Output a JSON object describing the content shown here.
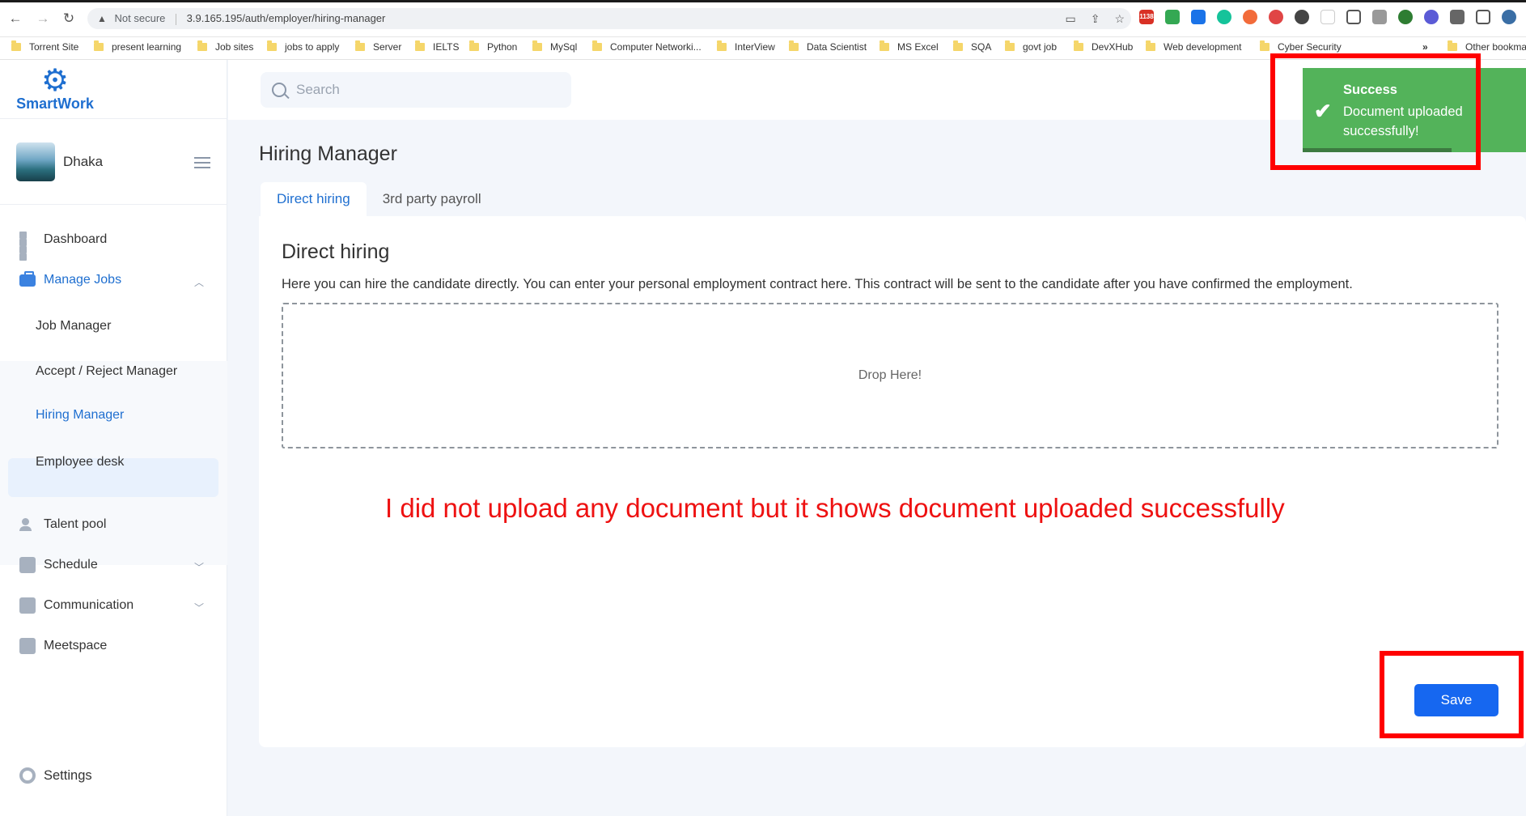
{
  "browser": {
    "not_secure": "Not secure",
    "url": "3.9.165.195/auth/employer/hiring-manager",
    "bookmarks": [
      "Torrent Site",
      "present learning",
      "Job sites",
      "jobs to apply",
      "Server",
      "IELTS",
      "Python",
      "MySql",
      "Computer Networki...",
      "InterView",
      "Data Scientist",
      "MS Excel",
      "SQA",
      "govt job",
      "DevXHub",
      "Web development",
      "Cyber Security"
    ],
    "more": "»",
    "other_bookmarks": "Other bookma",
    "gmail_badge": "1138"
  },
  "app": {
    "logo": "SmartWork",
    "profile_name": "Dhaka",
    "search_placeholder": "Search"
  },
  "sidebar": {
    "dashboard": "Dashboard",
    "manage_jobs": "Manage Jobs",
    "job_manager": "Job Manager",
    "accept_reject": "Accept / Reject Manager",
    "hiring_manager": "Hiring Manager",
    "employee_desk": "Employee desk",
    "talent_pool": "Talent pool",
    "schedule": "Schedule",
    "communication": "Communication",
    "meetspace": "Meetspace",
    "settings": "Settings"
  },
  "page": {
    "title": "Hiring Manager",
    "tabs": [
      "Direct hiring",
      "3rd party payroll"
    ],
    "card_title": "Direct hiring",
    "description": "Here you can hire the candidate directly. You can enter your personal employment contract here. This contract will be sent to the candidate after you have confirmed the employment.",
    "dropzone": "Drop Here!",
    "save": "Save"
  },
  "toast": {
    "title": "Success",
    "message": "Document uploaded successfully!"
  },
  "annotation": "I did not upload any document but it shows document uploaded successfully",
  "colors": {
    "accent": "#1f6fd0",
    "success": "#53b35a",
    "annotation": "#ff0000"
  }
}
